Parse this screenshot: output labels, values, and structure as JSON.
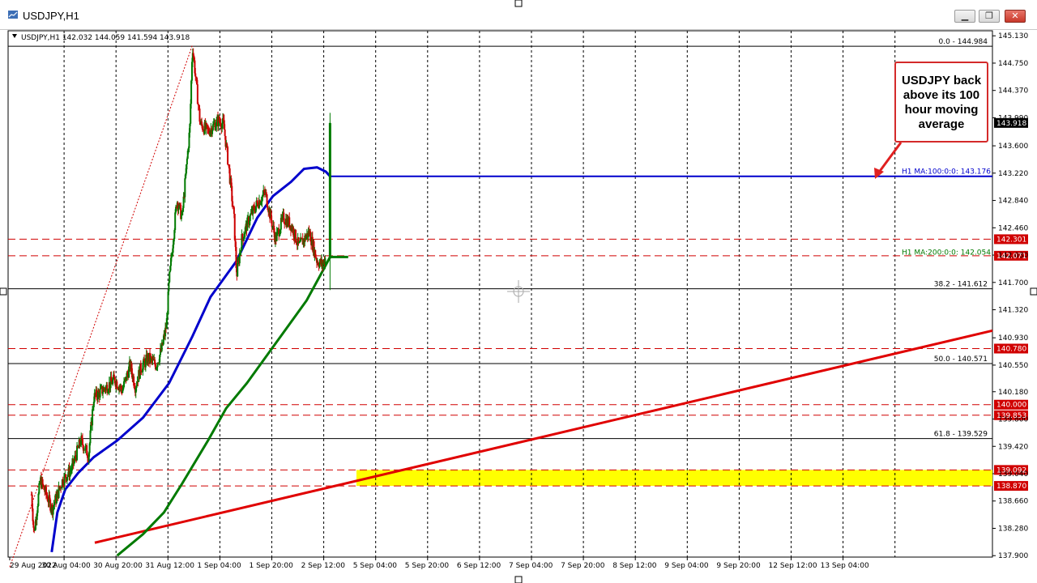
{
  "window": {
    "title": "USDJPY,H1",
    "buttons": {
      "minimize": "▁",
      "restore": "❐",
      "close": "✕"
    }
  },
  "chart_data": {
    "type": "candlestick",
    "symbol_info": "USDJPY,H1  142.032 144.059 141.594 143.918",
    "current_price": "143.918",
    "ylim": [
      137.88,
      145.2
    ],
    "y_ticks": [
      "145.130",
      "144.750",
      "144.370",
      "143.990",
      "143.600",
      "143.220",
      "142.840",
      "142.460",
      "142.080",
      "141.700",
      "141.320",
      "140.930",
      "140.550",
      "140.180",
      "139.800",
      "139.420",
      "139.040",
      "138.660",
      "138.280",
      "137.900"
    ],
    "x_ticks": [
      "29 Aug 2022",
      "30 Aug 04:00",
      "30 Aug 20:00",
      "31 Aug 12:00",
      "1 Sep 04:00",
      "1 Sep 20:00",
      "2 Sep 12:00",
      "5 Sep 04:00",
      "5 Sep 20:00",
      "6 Sep 12:00",
      "7 Sep 04:00",
      "7 Sep 20:00",
      "8 Sep 12:00",
      "9 Sep 04:00",
      "9 Sep 20:00",
      "12 Sep 12:00",
      "13 Sep 04:00"
    ],
    "fib_levels": [
      {
        "label": "0.0 - 144.984",
        "value": 144.984
      },
      {
        "label": "38.2 - 141.612",
        "value": 141.612
      },
      {
        "label": "50.0 - 140.571",
        "value": 140.571
      },
      {
        "label": "61.8 - 139.529",
        "value": 139.529
      }
    ],
    "hlines": [
      {
        "label": "142.301",
        "value": 142.301
      },
      {
        "label": "142.071",
        "value": 142.071
      },
      {
        "label": "140.780",
        "value": 140.78
      },
      {
        "label": "140.000",
        "value": 140.0
      },
      {
        "label": "139.853",
        "value": 139.853
      },
      {
        "label": "139.092",
        "value": 139.092
      },
      {
        "label": "138.870",
        "value": 138.87
      }
    ],
    "zone": {
      "from": 138.87,
      "to": 139.092,
      "color": "#ffff00"
    },
    "ma100": {
      "label": "H1 MA:100:0:0: 143.176",
      "color": "#0000cc",
      "points": [
        [
          0.34,
          137.95
        ],
        [
          0.45,
          138.5
        ],
        [
          0.6,
          138.82
        ],
        [
          0.85,
          139.05
        ],
        [
          1.15,
          139.27
        ],
        [
          1.6,
          139.5
        ],
        [
          2.1,
          139.82
        ],
        [
          2.6,
          140.3
        ],
        [
          3.05,
          140.95
        ],
        [
          3.4,
          141.5
        ],
        [
          3.9,
          142.0
        ],
        [
          4.3,
          142.6
        ],
        [
          4.6,
          142.9
        ],
        [
          4.95,
          143.1
        ],
        [
          5.2,
          143.28
        ],
        [
          5.45,
          143.3
        ],
        [
          5.62,
          143.24
        ],
        [
          5.7,
          143.176
        ]
      ]
    },
    "ma200": {
      "label": "H1 MA:200:0:0: 142.054",
      "color": "#007a00",
      "points": [
        [
          1.6,
          137.9
        ],
        [
          2.1,
          138.2
        ],
        [
          2.5,
          138.5
        ],
        [
          2.85,
          138.9
        ],
        [
          3.35,
          139.5
        ],
        [
          3.7,
          139.95
        ],
        [
          4.1,
          140.3
        ],
        [
          4.5,
          140.7
        ],
        [
          4.85,
          141.05
        ],
        [
          5.25,
          141.45
        ],
        [
          5.55,
          141.85
        ],
        [
          5.7,
          142.054
        ],
        [
          6.05,
          142.054
        ]
      ]
    },
    "trendline": {
      "color": "#e00000",
      "points": [
        [
          0.0,
          138.08
        ],
        [
          6.05,
          141.03
        ]
      ]
    },
    "fib_anchor_line": {
      "from": [
        0.0,
        138.08
      ],
      "to": [
        3.05,
        145.0
      ]
    },
    "price_path": [
      [
        -0.05,
        138.75
      ],
      [
        0.0,
        138.2
      ],
      [
        0.12,
        138.95
      ],
      [
        0.35,
        138.55
      ],
      [
        0.55,
        138.95
      ],
      [
        0.72,
        139.1
      ],
      [
        0.9,
        139.5
      ],
      [
        1.05,
        139.3
      ],
      [
        1.15,
        140.1
      ],
      [
        1.4,
        140.25
      ],
      [
        1.55,
        140.35
      ],
      [
        1.7,
        140.2
      ],
      [
        1.85,
        140.55
      ],
      [
        1.95,
        140.25
      ],
      [
        2.05,
        140.5
      ],
      [
        2.2,
        140.65
      ],
      [
        2.35,
        140.55
      ],
      [
        2.45,
        140.75
      ],
      [
        2.55,
        141.1
      ],
      [
        2.6,
        141.7
      ],
      [
        2.75,
        142.85
      ],
      [
        2.85,
        142.6
      ],
      [
        3.0,
        143.85
      ],
      [
        3.05,
        145.0
      ],
      [
        3.2,
        143.9
      ],
      [
        3.35,
        143.8
      ],
      [
        3.55,
        143.95
      ],
      [
        3.65,
        143.9
      ],
      [
        3.75,
        143.3
      ],
      [
        3.85,
        142.6
      ],
      [
        3.9,
        141.8
      ],
      [
        4.0,
        142.3
      ],
      [
        4.15,
        142.6
      ],
      [
        4.3,
        142.8
      ],
      [
        4.45,
        142.95
      ],
      [
        4.65,
        142.3
      ],
      [
        4.8,
        142.6
      ],
      [
        4.95,
        142.5
      ],
      [
        5.1,
        142.2
      ],
      [
        5.3,
        142.4
      ],
      [
        5.45,
        142.0
      ],
      [
        5.55,
        141.95
      ],
      [
        5.62,
        142.05
      ],
      [
        5.7,
        143.918
      ]
    ],
    "callout_text": "USDJPY back above its 100 hour moving average"
  }
}
